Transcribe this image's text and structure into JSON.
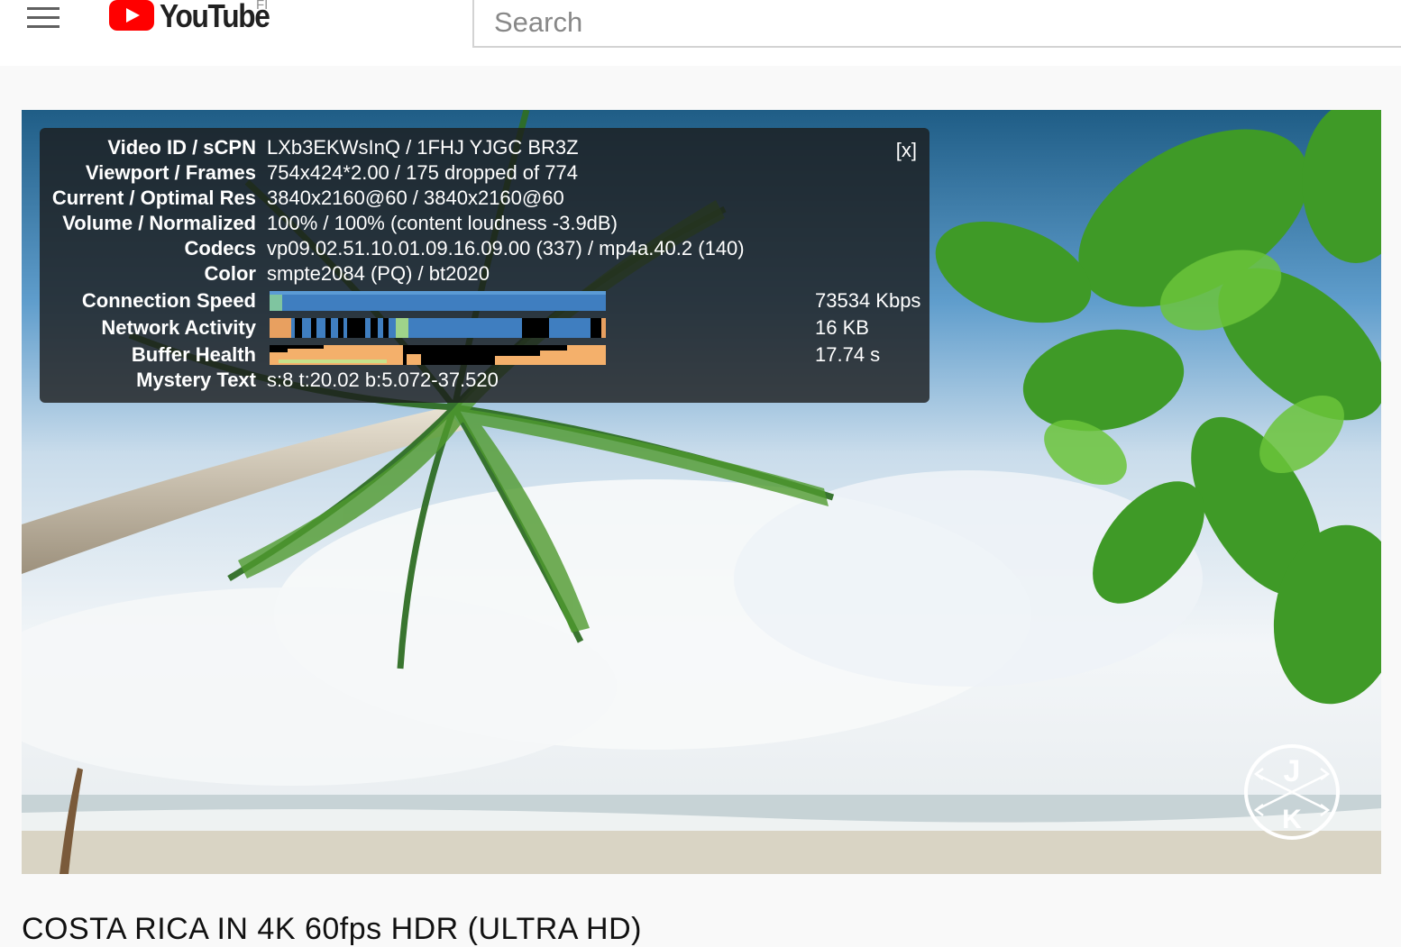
{
  "header": {
    "menu_icon": "hamburger-menu-icon",
    "logo_text": "YouTube",
    "country_code": "FI",
    "search_placeholder": "Search"
  },
  "player": {
    "watermark": "J K",
    "stats": {
      "close_label": "[x]",
      "rows": [
        {
          "label": "Video ID / sCPN",
          "value": "LXb3EKWsInQ / 1FHJ YJGC BR3Z"
        },
        {
          "label": "Viewport / Frames",
          "value": "754x424*2.00 / 175 dropped of 774"
        },
        {
          "label": "Current / Optimal Res",
          "value": "3840x2160@60 / 3840x2160@60"
        },
        {
          "label": "Volume / Normalized",
          "value": "100% / 100% (content loudness -3.9dB)"
        },
        {
          "label": "Codecs",
          "value": "vp09.02.51.10.01.09.16.09.00 (337) / mp4a.40.2 (140)"
        },
        {
          "label": "Color",
          "value": "smpte2084 (PQ) / bt2020"
        }
      ],
      "graphs": [
        {
          "label": "Connection Speed",
          "value": "73534 Kbps"
        },
        {
          "label": "Network Activity",
          "value": "16 KB"
        },
        {
          "label": "Buffer Health",
          "value": "17.74 s"
        }
      ],
      "mystery": {
        "label": "Mystery Text",
        "value": "s:8 t:20.02 b:5.072-37.520"
      }
    }
  },
  "video": {
    "title": "COSTA RICA IN 4K 60fps HDR (ULTRA HD)"
  },
  "colors": {
    "brand_red": "#ff0000",
    "graph_blue": "#3f7ec0",
    "graph_orange": "#f4b06b"
  }
}
